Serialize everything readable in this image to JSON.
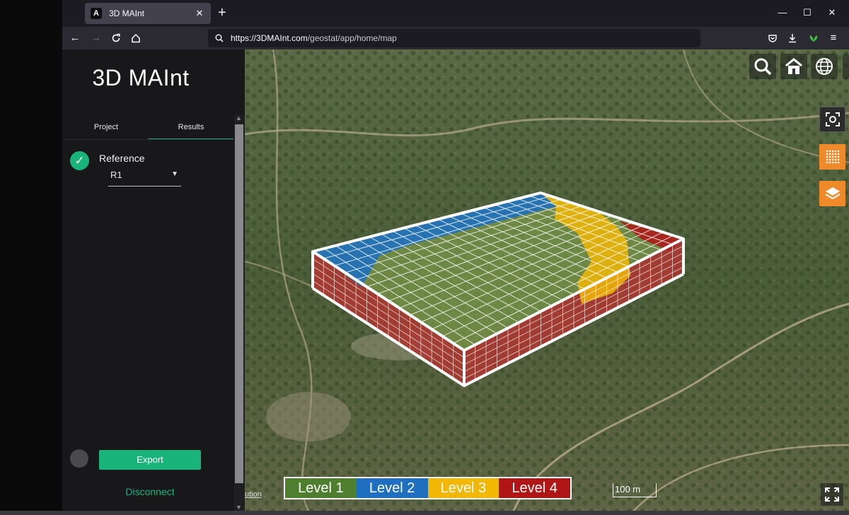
{
  "browser": {
    "tab_title": "3D MAInt",
    "tab_favicon_letter": "A",
    "tab_close": "✕",
    "new_tab": "+",
    "url_host": "https://3DMAInt.com",
    "url_path": "/geostat/app/home/map",
    "window_controls": {
      "minimize": "—",
      "maximize": "☐",
      "close": "✕"
    }
  },
  "sidebar": {
    "app_title": "3D MAInt",
    "tabs": [
      {
        "label": "Project",
        "active": false
      },
      {
        "label": "Results",
        "active": true
      }
    ],
    "reference": {
      "label": "Reference",
      "check": "✓",
      "selected": "R1"
    },
    "export_label": "Export",
    "disconnect_label": "Disconnect"
  },
  "map": {
    "legend": [
      {
        "label": "Level 1",
        "color": "#4e7f2e"
      },
      {
        "label": "Level 2",
        "color": "#1e6fc0"
      },
      {
        "label": "Level 3",
        "color": "#f2b705"
      },
      {
        "label": "Level 4",
        "color": "#b01616"
      }
    ],
    "scale_label": "100 m",
    "attribution": "ution",
    "toolbar": [
      "search-icon",
      "home-icon",
      "globe-icon",
      "basemap-icon",
      "help-icon"
    ],
    "side_tools": [
      "focus-icon",
      "grid-icon",
      "layers-icon"
    ]
  },
  "colors": {
    "accent": "#19b47b",
    "orange": "#ef8a2b",
    "sidebar_bg": "#18181b"
  }
}
